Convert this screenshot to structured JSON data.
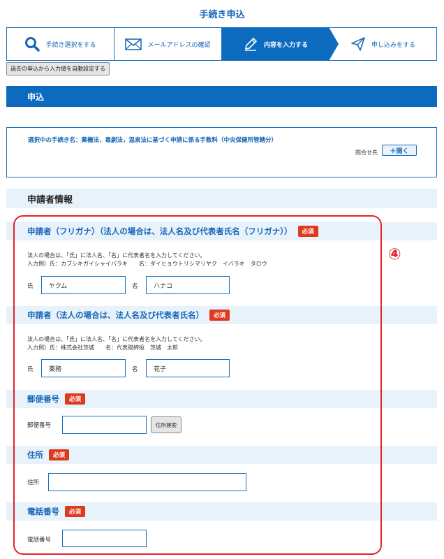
{
  "page": {
    "title": "手続き申込"
  },
  "steps": [
    {
      "label": "手続き選択をする",
      "icon": "search-icon",
      "active": false
    },
    {
      "label": "メールアドレスの確認",
      "icon": "envelope-icon",
      "active": false
    },
    {
      "label": "内容を入力する",
      "icon": "pencil-icon",
      "active": true
    },
    {
      "label": "申し込みをする",
      "icon": "paper-plane-icon",
      "active": false
    }
  ],
  "autofill": {
    "label": "過去の申込から入力値を自動設定する"
  },
  "section": {
    "title": "申込"
  },
  "procedure": {
    "text": "選択中の手続き名：薬機法，毒劇法，温泉法に基づく申請に係る手数料（中央保健所管轄分）",
    "contact_label": "問合せ先",
    "open_label": "＋開く"
  },
  "applicant": {
    "title": "申請者情報"
  },
  "required_label": "必須",
  "fields": {
    "furigana": {
      "title": "申請者（フリガナ）（法人の場合は、法人名及び代表者氏名（フリガナ））",
      "note1": "法人の場合は、「氏」に法人名、「名」に代表者名を入力してください。",
      "note2": "入力例）氏：カブシキガイシャイバラキ　　名：ダイヒョウトリシマリヤク　イバラキ　タロウ",
      "sei_label": "氏",
      "sei_value": "ヤクム",
      "mei_label": "名",
      "mei_value": "ハナコ"
    },
    "name": {
      "title": "申請者（法人の場合は、法人名及び代表者氏名）",
      "note1": "法人の場合は、「氏」に法人名、「名」に代表者名を入力してください。",
      "note2": "入力例）氏：株式会社茨城　　名：代表取締役　茨城　太郎",
      "sei_label": "氏",
      "sei_value": "薬務",
      "mei_label": "名",
      "mei_value": "花子"
    },
    "postal": {
      "title": "郵便番号",
      "label": "郵便番号",
      "value": "",
      "search_label": "住所検索"
    },
    "address": {
      "title": "住所",
      "label": "住所",
      "value": ""
    },
    "phone": {
      "title": "電話番号",
      "label": "電話番号",
      "value": ""
    }
  },
  "annotation": {
    "number": "④"
  },
  "colors": {
    "primary": "#0d6bbf",
    "required": "#e03a1e",
    "highlight": "#e5202a",
    "header_bg": "#e8f2fb"
  }
}
